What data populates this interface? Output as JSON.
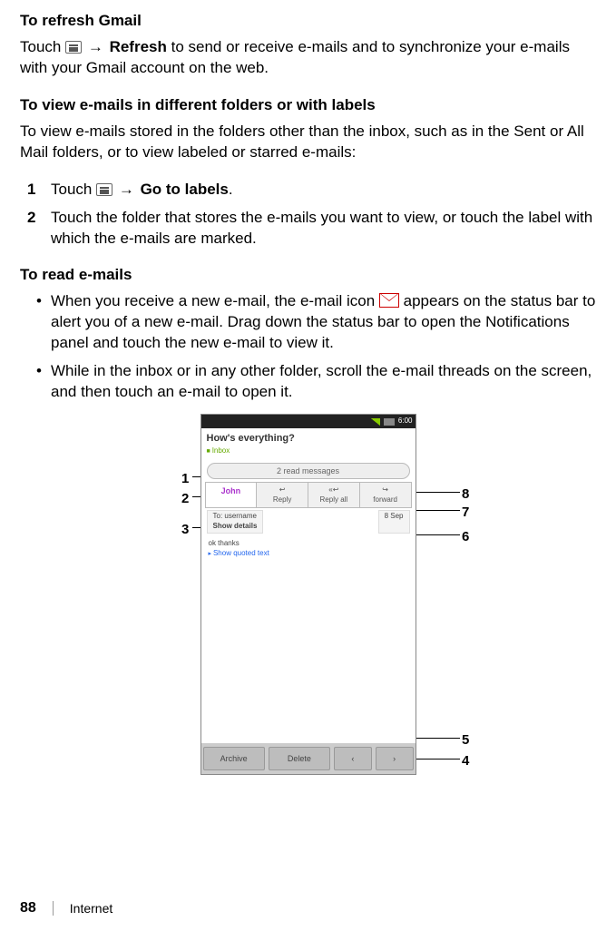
{
  "section1": {
    "heading": "To refresh Gmail",
    "para_pre": "Touch ",
    "arrow": "→",
    "refresh_word": "Refresh",
    "para_post": " to send or receive e-mails and to synchronize your e-mails with your Gmail account on the web."
  },
  "section2": {
    "heading": "To view e-mails in different folders or with labels",
    "para": "To view e-mails stored in the folders other than the inbox, such as in the Sent or All Mail folders, or to view labeled or starred e-mails:",
    "steps": [
      {
        "num": "1",
        "pre": "Touch ",
        "arrow": "→",
        "bold": "Go to labels",
        "post": "."
      },
      {
        "num": "2",
        "text": "Touch the folder that stores the e-mails you want to view, or touch the label with which the e-mails are marked."
      }
    ]
  },
  "section3": {
    "heading": "To read e-mails",
    "bullets": [
      {
        "pre": "When you receive a new e-mail, the e-mail icon ",
        "post": " appears on the status bar to alert you of a new e-mail. Drag down the status bar to open the Notifications panel and touch the new e-mail to view it."
      },
      {
        "text": "While in the inbox or in any other folder, scroll the e-mail threads on the screen, and then touch an e-mail to open it."
      }
    ]
  },
  "screenshot": {
    "time": "6:00",
    "subject": "How's everything?",
    "label": "Inbox",
    "read_messages": "2 read messages",
    "sender": "John",
    "btn_reply": "Reply",
    "btn_reply_all": "Reply all",
    "btn_forward": "forward",
    "to_line": "To: username",
    "show_details": "Show details",
    "date": "8 Sep",
    "body_text": "ok thanks",
    "quoted": "Show quoted text",
    "archive": "Archive",
    "delete": "Delete",
    "callouts": {
      "c1": "1",
      "c2": "2",
      "c3": "3",
      "c4": "4",
      "c5": "5",
      "c6": "6",
      "c7": "7",
      "c8": "8"
    }
  },
  "footer": {
    "page": "88",
    "chapter": "Internet"
  }
}
